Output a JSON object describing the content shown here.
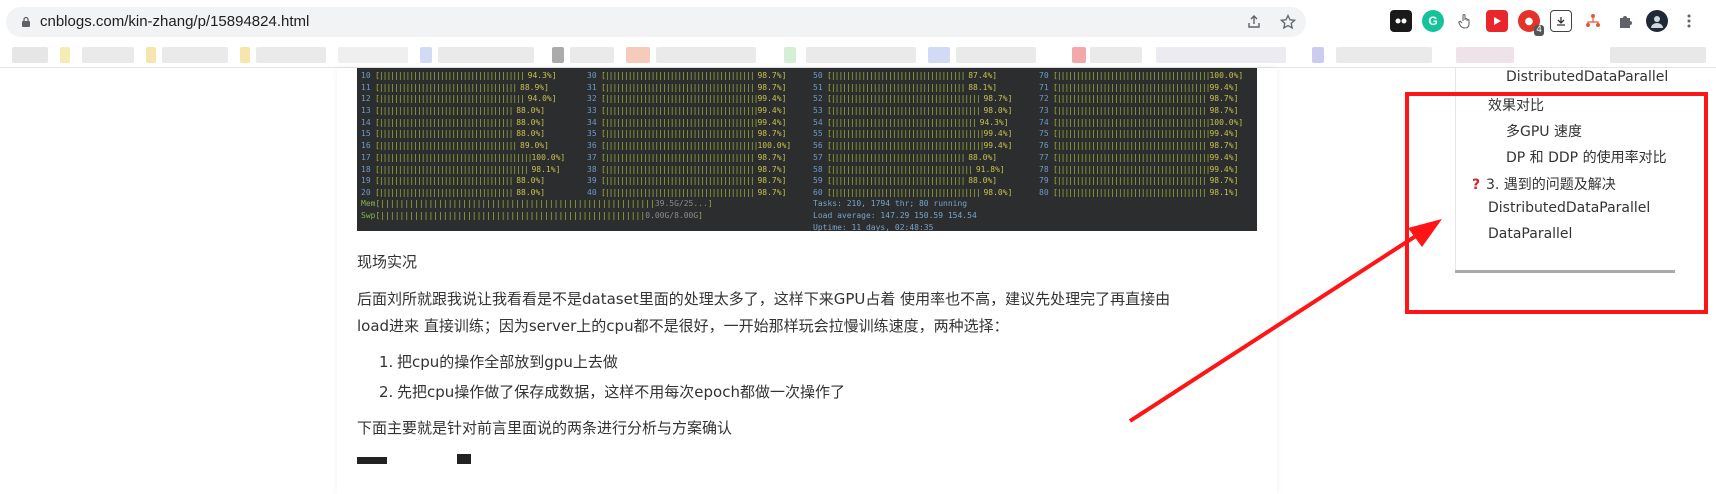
{
  "browser": {
    "url": "cnblogs.com/kin-zhang/p/15894824.html",
    "ext_badge": "4",
    "icons": [
      "share-icon",
      "star-icon",
      "extension-icon",
      "profile-avatar",
      "menu-icon"
    ]
  },
  "terminal": {
    "col1": [
      {
        "n": "10",
        "pct": "94.3"
      },
      {
        "n": "11",
        "pct": "88.9"
      },
      {
        "n": "12",
        "pct": "94.0"
      },
      {
        "n": "13",
        "pct": "88.0"
      },
      {
        "n": "14",
        "pct": "88.0"
      },
      {
        "n": "15",
        "pct": "88.0"
      },
      {
        "n": "16",
        "pct": "89.0"
      },
      {
        "n": "17",
        "pct": "100.0"
      },
      {
        "n": "18",
        "pct": "98.1"
      },
      {
        "n": "19",
        "pct": "88.0"
      },
      {
        "n": "20",
        "pct": "88.0"
      }
    ],
    "col2": [
      {
        "n": "30",
        "pct": "98.7"
      },
      {
        "n": "31",
        "pct": "98.7"
      },
      {
        "n": "32",
        "pct": "99.4"
      },
      {
        "n": "33",
        "pct": "99.4"
      },
      {
        "n": "34",
        "pct": "99.4"
      },
      {
        "n": "35",
        "pct": "98.7"
      },
      {
        "n": "36",
        "pct": "100.0"
      },
      {
        "n": "37",
        "pct": "98.7"
      },
      {
        "n": "38",
        "pct": "98.7"
      },
      {
        "n": "39",
        "pct": "98.7"
      },
      {
        "n": "40",
        "pct": "98.7"
      }
    ],
    "col3": [
      {
        "n": "50",
        "pct": "87.4"
      },
      {
        "n": "51",
        "pct": "88.1"
      },
      {
        "n": "52",
        "pct": "98.7"
      },
      {
        "n": "53",
        "pct": "98.0"
      },
      {
        "n": "54",
        "pct": "94.3"
      },
      {
        "n": "55",
        "pct": "99.4"
      },
      {
        "n": "56",
        "pct": "99.4"
      },
      {
        "n": "57",
        "pct": "88.0"
      },
      {
        "n": "58",
        "pct": "91.8"
      },
      {
        "n": "59",
        "pct": "88.0"
      },
      {
        "n": "60",
        "pct": "98.0"
      }
    ],
    "col4": [
      {
        "n": "70",
        "pct": "100.0"
      },
      {
        "n": "71",
        "pct": "99.4"
      },
      {
        "n": "72",
        "pct": "98.7"
      },
      {
        "n": "73",
        "pct": "98.7"
      },
      {
        "n": "74",
        "pct": "100.0"
      },
      {
        "n": "75",
        "pct": "99.4"
      },
      {
        "n": "76",
        "pct": "98.7"
      },
      {
        "n": "77",
        "pct": "99.4"
      },
      {
        "n": "78",
        "pct": "99.4"
      },
      {
        "n": "79",
        "pct": "98.7"
      },
      {
        "n": "80",
        "pct": "98.1"
      }
    ],
    "mem_label": "Mem",
    "mem_value": "39.5G/25...",
    "swp_label": "Swp",
    "swp_value": "0.00G/8.00G",
    "tasks": "Tasks: 210, 1794 thr; 80 running",
    "load": "Load average: 147.29 150.59 154.54",
    "uptime": "Uptime: 11 days, 02:48:35"
  },
  "article": {
    "heading_live": "现场实况",
    "para1_line1": "后面刘所就跟我说让我看看是不是dataset里面的处理太多了，这样下来GPU占着 使用率也不高，建议先处理完了再直接由",
    "para1_line2": "load进来 直接训练；因为server上的cpu都不是很好，一开始那样玩会拉慢训练速度，两种选择：",
    "list": [
      {
        "num": "1.",
        "text": "把cpu的操作全部放到gpu上去做"
      },
      {
        "num": "2.",
        "text": "先把cpu操作做了保存成数据，这样不用每次epoch都做一次操作了"
      }
    ],
    "para2": "下面主要就是针对前言里面说的两条进行分析与方案确认"
  },
  "toc": {
    "items": [
      {
        "label": "DistributedDataParallel",
        "level": 2
      },
      {
        "label": "效果对比",
        "level": 1
      },
      {
        "label": "多GPU 速度",
        "level": 2
      },
      {
        "label": "DP 和 DDP 的使用率对比",
        "level": 2
      },
      {
        "label": "3. 遇到的问题及解决",
        "level": 0
      },
      {
        "label": "DistributedDataParallel",
        "level": 1
      },
      {
        "label": "DataParallel",
        "level": 1
      }
    ],
    "question_mark": "?"
  },
  "colors": {
    "annotation_red": "#ff1515",
    "terminal_bg": "#2b2d2e"
  }
}
